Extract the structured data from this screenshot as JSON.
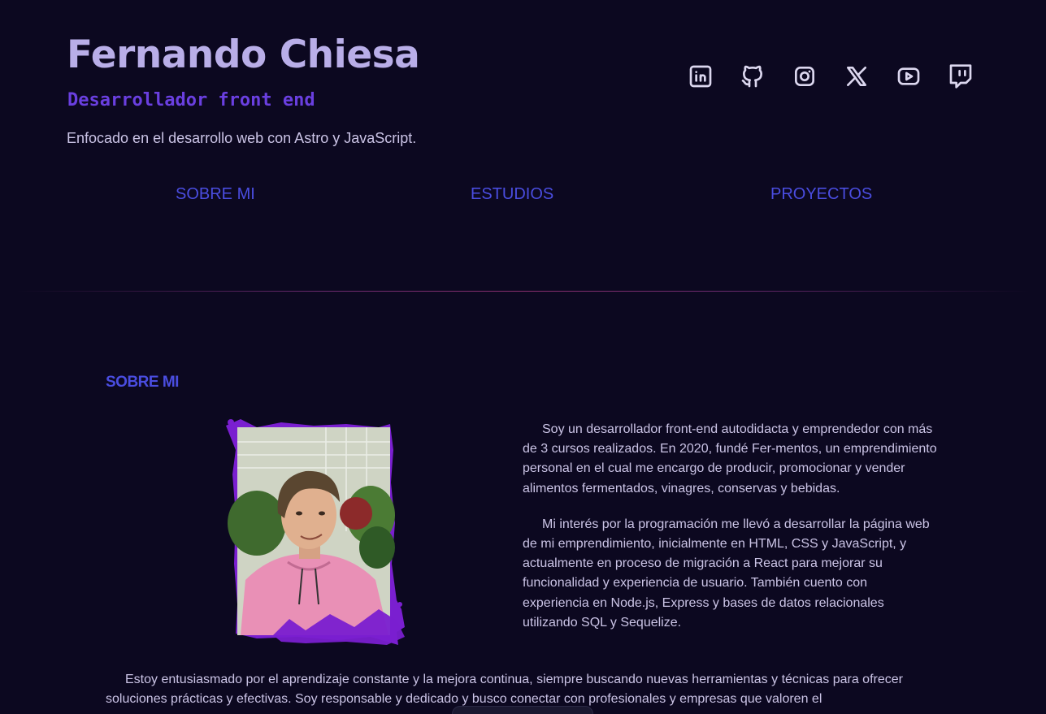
{
  "header": {
    "name": "Fernando Chiesa",
    "role": "Desarrollador front end",
    "tagline": "Enfocado en el desarrollo web con Astro y JavaScript."
  },
  "social": [
    {
      "label": "LinkedIn",
      "icon": "linkedin-icon"
    },
    {
      "label": "GitHub",
      "icon": "github-icon"
    },
    {
      "label": "Instagram",
      "icon": "instagram-icon"
    },
    {
      "label": "X",
      "icon": "x-icon"
    },
    {
      "label": "YouTube",
      "icon": "youtube-icon"
    },
    {
      "label": "Twitch",
      "icon": "twitch-icon"
    }
  ],
  "nav": {
    "about": "SOBRE MI",
    "studies": "ESTUDIOS",
    "projects": "PROYECTOS"
  },
  "about": {
    "title": "SOBRE MI",
    "paragraphs": [
      "Soy un desarrollador front-end autodidacta y emprendedor con más de 3 cursos realizados. En 2020, fundé Fer-mentos, un emprendimiento personal en el cual me encargo de producir, promocionar y vender alimentos fermentados, vinagres, conservas y bebidas.",
      "Mi interés por la programación me llevó a desarrollar la página web de mi emprendimiento, inicialmente en HTML, CSS y JavaScript, y actualmente en proceso de migración a React para mejorar su funcionalidad y experiencia de usuario. También cuento con experiencia en Node.js, Express y bases de datos relacionales utilizando SQL y Sequelize."
    ],
    "bottom": "Estoy entusiasmado por el aprendizaje constante y la mejora continua, siempre buscando nuevas herramientas y técnicas para ofrecer soluciones prácticas y efectivas. Soy responsable y dedicado y busco conectar con profesionales y empresas que valoren el"
  },
  "colors": {
    "background": "#0c0820",
    "accent": "#4a4de0",
    "role": "#6a3fe0",
    "frame": "#7a1fd0"
  }
}
